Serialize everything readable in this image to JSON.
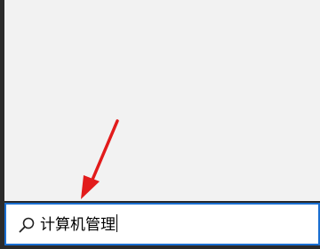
{
  "search": {
    "query": "计算机管理"
  },
  "colors": {
    "window_background": "#f2f2f2",
    "frame": "#2b2b2b",
    "search_focus_border": "#1a6fd1",
    "annotation_arrow": "#e21b1b"
  },
  "icons": {
    "search": "search-icon",
    "annotation": "red-arrow-annotation"
  }
}
